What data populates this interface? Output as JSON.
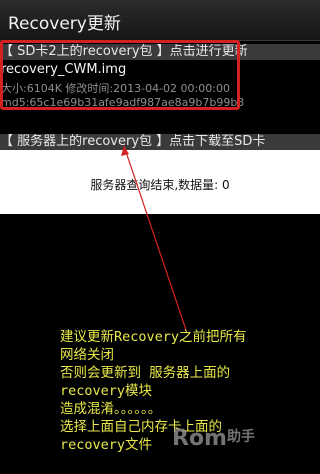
{
  "app": {
    "title": "Recovery更新"
  },
  "sd_section": {
    "header": "【 SD卡2上的recovery包 】点击进行更新"
  },
  "sd_file": {
    "name": "recovery_CWM.img",
    "meta": "大小:6104K 修改时间:2013-04-02 00:00:00",
    "md5": "md5:65c1e69b31afe9adf987ae8a9b7b99b3"
  },
  "server_section": {
    "header": "【 服务器上的recovery包 】点击下载至SD卡"
  },
  "server_status": {
    "text": "服务器查询结束,数据量: 0"
  },
  "annotation": {
    "lines": [
      "建议更新Recovery之前把所有",
      "网络关闭",
      "否则会更新到 服务器上面的",
      "recovery模块",
      "造成混淆。。。。。。",
      "选择上面自己内存卡上面的",
      "recovery文件"
    ]
  },
  "watermark": {
    "text": "Rom",
    "sub": "助手"
  },
  "colors": {
    "highlight": "#d32222",
    "annotation": "#e8e84a"
  }
}
